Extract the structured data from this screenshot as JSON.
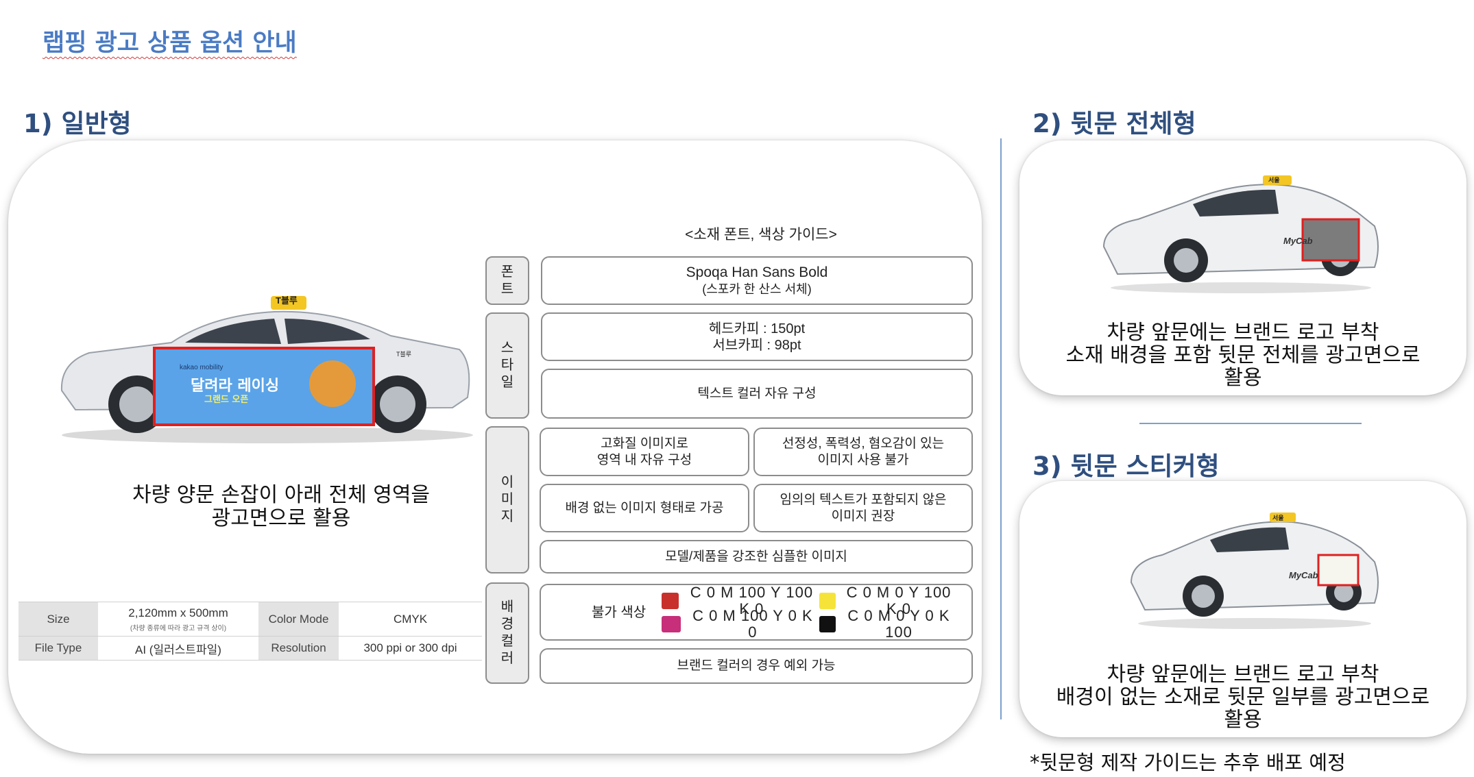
{
  "page_title": "랩핑 광고 상품 옵션 안내",
  "sections": {
    "general": {
      "title": "1) 일반형",
      "caption": [
        "차량 양문 손잡이 아래 전체 영역을",
        "광고면으로 활용"
      ],
      "car_ad": {
        "brand": "kakao mobility",
        "headline": "달려라 레이싱",
        "sub": "그랜드 오픈",
        "roof_sign": "T블루",
        "door_mark": "T블루"
      },
      "spec_table": {
        "size_label": "Size",
        "size_value": "2,120mm x 500mm",
        "size_note": "(차량 종류에 따라 광고 규격 상이)",
        "color_mode_label": "Color Mode",
        "color_mode_value": "CMYK",
        "file_type_label": "File Type",
        "file_type_value": "AI (일러스트파일)",
        "resolution_label": "Resolution",
        "resolution_value": "300 ppi or 300 dpi"
      }
    },
    "rear_full": {
      "title": "2) 뒷문 전체형",
      "caption": [
        "차량 앞문에는 브랜드 로고 부착",
        "소재 배경을 포함 뒷문 전체를 광고면으로",
        "활용"
      ],
      "car_text": {
        "logo": "MyCab",
        "roof_sign": "서울"
      }
    },
    "rear_sticker": {
      "title": "3) 뒷문 스티커형",
      "caption": [
        "차량 앞문에는 브랜드 로고 부착",
        "배경이 없는 소재로 뒷문 일부를 광고면으로",
        "활용"
      ],
      "car_text": {
        "logo": "MyCab",
        "roof_sign": "서울"
      }
    }
  },
  "guide": {
    "title": "<소재 폰트, 색상 가이드>",
    "font": {
      "label": [
        "폰",
        "트"
      ],
      "line1": "Spoqa Han Sans Bold",
      "line2": "(스포카 한 산스 서체)"
    },
    "style": {
      "label": [
        "스",
        "타",
        "일"
      ],
      "line1": "헤드카피 : 150pt",
      "line2": "서브카피 : 98pt",
      "free_color": "텍스트 컬러 자유 구성"
    },
    "image": {
      "label": [
        "이",
        "미",
        "지"
      ],
      "box1": [
        "고화질 이미지로",
        "영역 내 자유 구성"
      ],
      "box2": [
        "선정성, 폭력성, 혐오감이 있는",
        "이미지 사용 불가"
      ],
      "box3": "배경 없는 이미지 형태로 가공",
      "box4": [
        "임의의 텍스트가 포함되지 않은",
        "이미지 권장"
      ],
      "box5": "모델/제품을 강조한 심플한 이미지"
    },
    "bg_color": {
      "label": [
        "배",
        "경",
        "컬",
        "러"
      ],
      "forbidden_label": "불가 색상",
      "colors": [
        {
          "code": "C 0 M 100 Y 100 K 0",
          "hex": "#c8302c"
        },
        {
          "code": "C 0 M 0 Y 100 K 0",
          "hex": "#f5e33a"
        },
        {
          "code": "C 0 M 100 Y 0 K 0",
          "hex": "#c72f7a"
        },
        {
          "code": "C 0 M 0 Y 0 K 100",
          "hex": "#111111"
        }
      ],
      "brand_exception": "브랜드 컬러의 경우 예외 가능"
    }
  },
  "footnote": "*뒷문형 제작 가이드는 추후 배포 예정"
}
